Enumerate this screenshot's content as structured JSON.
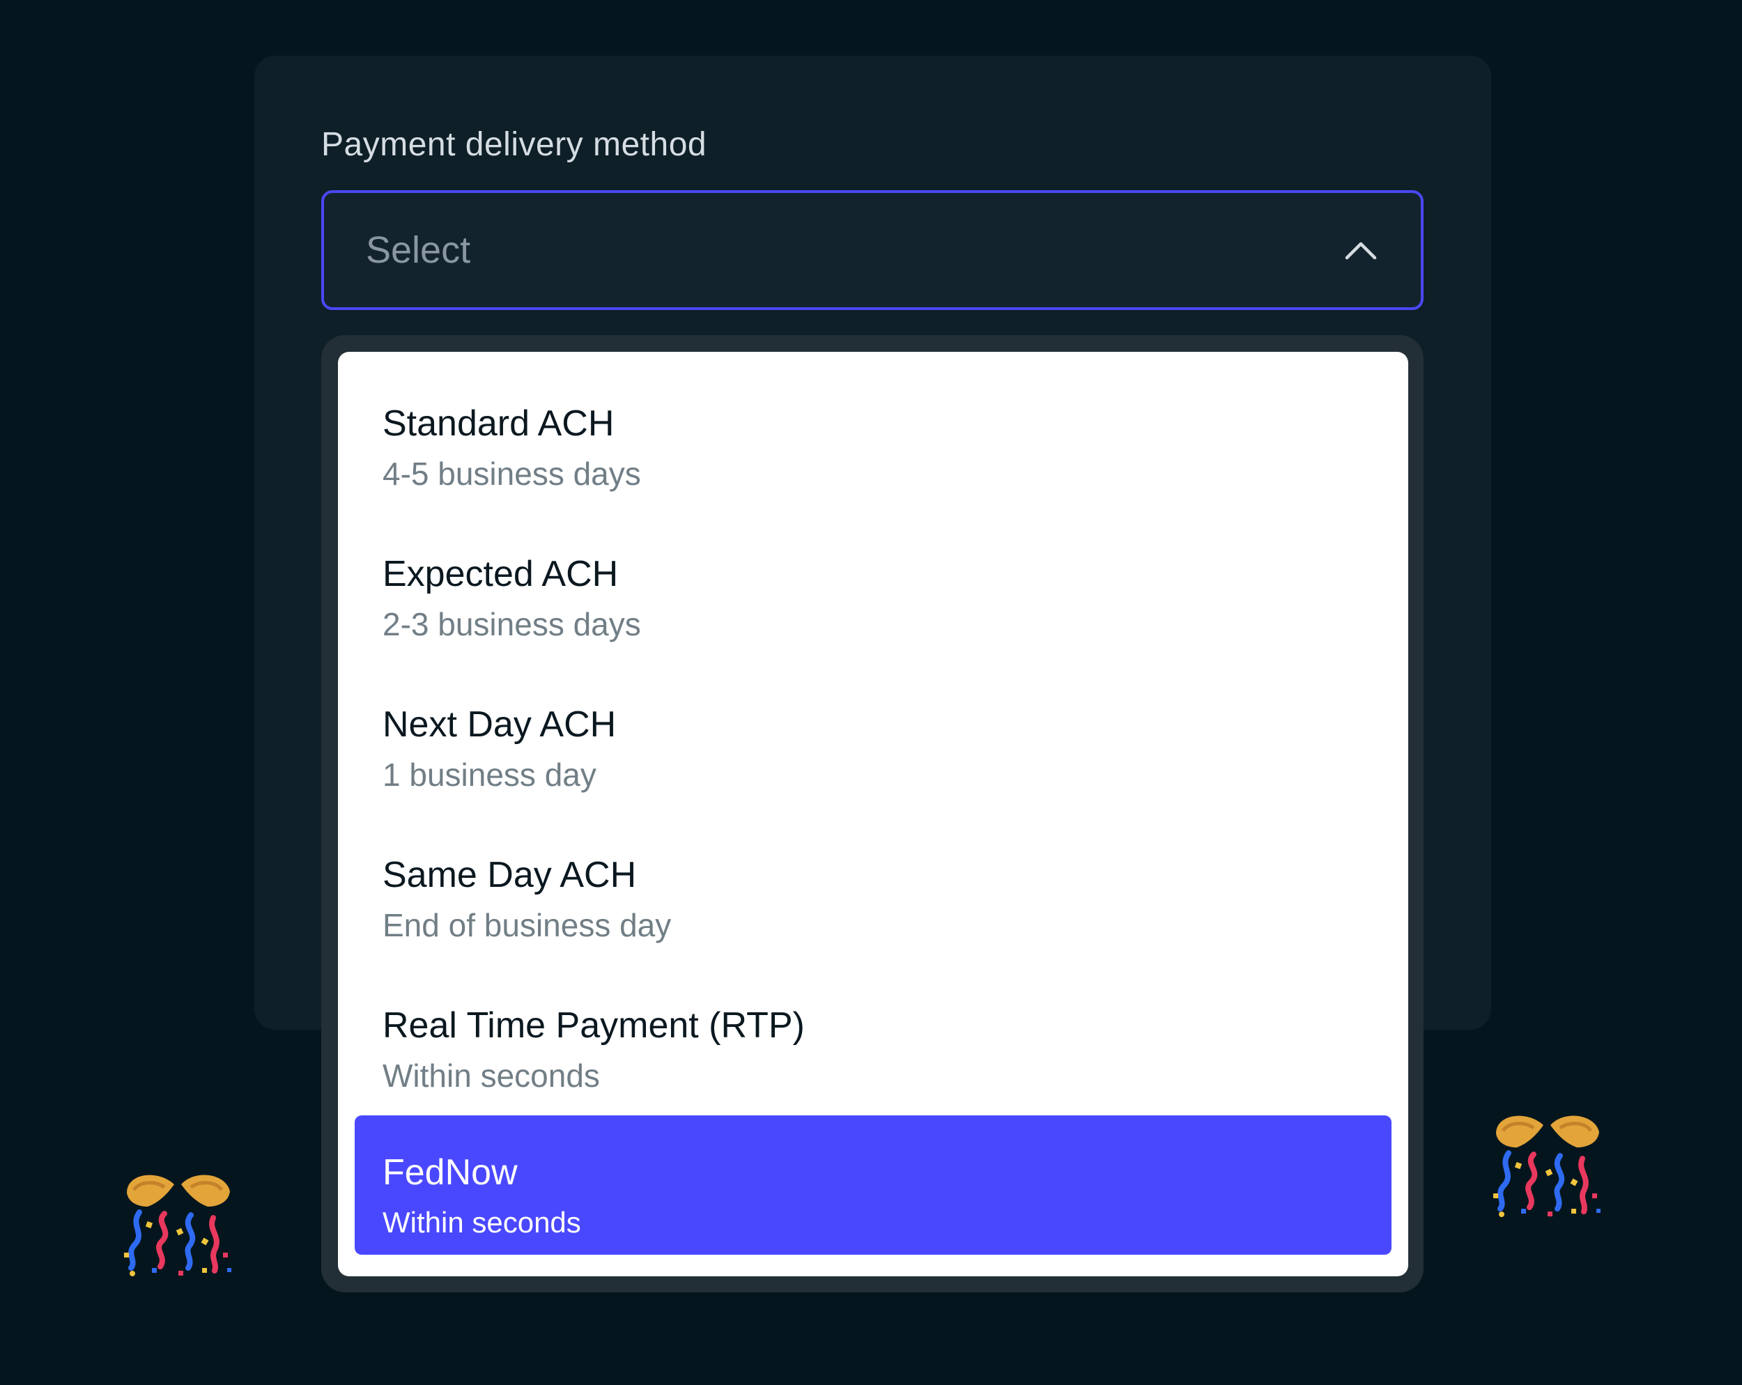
{
  "field": {
    "label": "Payment delivery method",
    "placeholder": "Select"
  },
  "dropdown": {
    "options": [
      {
        "title": "Standard ACH",
        "subtitle": "4-5 business days"
      },
      {
        "title": "Expected ACH",
        "subtitle": "2-3 business days"
      },
      {
        "title": "Next Day ACH",
        "subtitle": "1 business day"
      },
      {
        "title": "Same Day ACH",
        "subtitle": "End of business day"
      },
      {
        "title": "Real Time Payment (RTP)",
        "subtitle": "Within seconds"
      },
      {
        "title": "FedNow",
        "subtitle": "Within seconds",
        "selected": true
      }
    ]
  },
  "decorations": {
    "left_icon": "party-popper-icon",
    "right_icon": "party-popper-icon"
  },
  "colors": {
    "background": "#04151d",
    "card": "#0e1f28",
    "focus_border": "#4a48f5",
    "selected_option": "#4a48ff"
  }
}
